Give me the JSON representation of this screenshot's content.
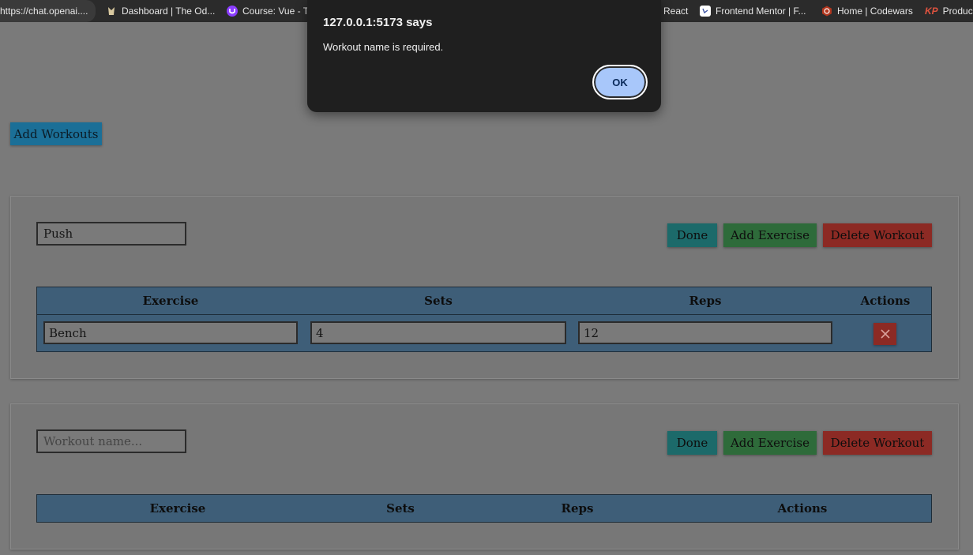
{
  "bookmarks": [
    {
      "label": "https://chat.openai....",
      "icon": "globe-icon"
    },
    {
      "label": "Dashboard | The Od...",
      "icon": "odin-icon"
    },
    {
      "label": "Course: Vue - T",
      "icon": "udemy-icon"
    },
    {
      "label": "React",
      "icon": "react-icon"
    },
    {
      "label": "Frontend Mentor | F...",
      "icon": "frontend-mentor-icon"
    },
    {
      "label": "Home | Codewars",
      "icon": "codewars-icon"
    },
    {
      "label": "Produc",
      "icon": "kp-icon",
      "icon_text": "KP"
    }
  ],
  "add_workouts_label": "Add Workouts",
  "workout_1": {
    "name_value": "Push",
    "done_label": "Done",
    "add_exercise_label": "Add Exercise",
    "delete_workout_label": "Delete Workout",
    "headers": [
      "Exercise",
      "Sets",
      "Reps",
      "Actions"
    ],
    "rows": [
      {
        "exercise": "Bench",
        "sets": "4",
        "reps": "12",
        "delete_icon": "close-icon"
      }
    ]
  },
  "workout_2": {
    "name_placeholder": "Workout name...",
    "done_label": "Done",
    "add_exercise_label": "Add Exercise",
    "delete_workout_label": "Delete Workout",
    "headers": [
      "Exercise",
      "Sets",
      "Reps",
      "Actions"
    ]
  },
  "dialog": {
    "title": "127.0.0.1:5173 says",
    "message": "Workout name is required.",
    "ok_label": "OK"
  },
  "colors": {
    "page_bg": "#7a7a7a",
    "add_workouts_bg": "#1b6f97",
    "done_bg": "#1c6a6a",
    "add_exercise_bg": "#2e6b3a",
    "delete_bg": "#8c2a24",
    "table_bg": "#3e5e78",
    "dialog_bg": "#1f1f1f",
    "ok_bg": "#a8c7fa"
  }
}
